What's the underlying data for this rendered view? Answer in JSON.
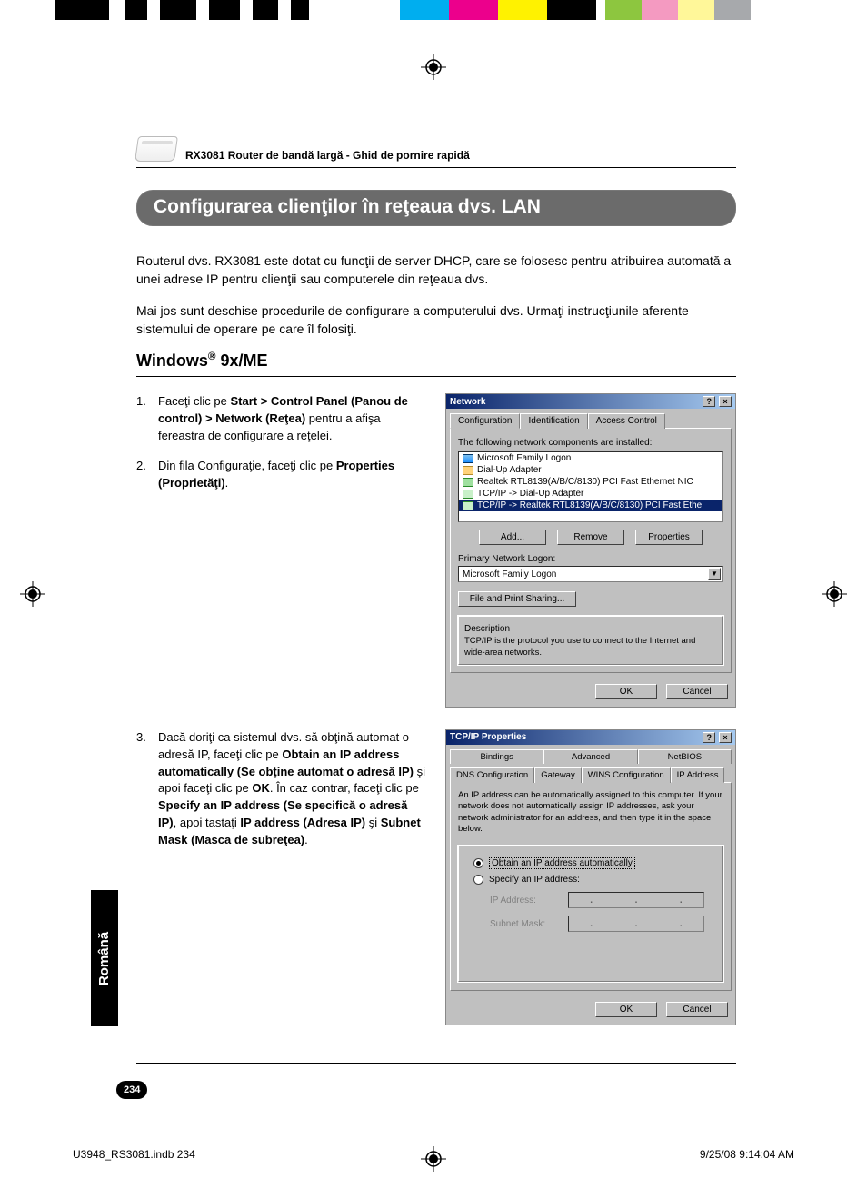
{
  "header": {
    "doc_title": "RX3081 Router de bandă largă - Ghid de pornire rapidă"
  },
  "section": {
    "title": "Configurarea clienţilor în reţeaua dvs. LAN"
  },
  "intro": {
    "p1": "Routerul dvs. RX3081 este dotat cu funcţii de server DHCP, care se folosesc pentru atribuirea automată a unei adrese IP pentru clienţii sau computerele din reţeaua dvs.",
    "p2": "Mai jos sunt deschise procedurile de configurare a computerului dvs. Urmaţi instrucţiunile aferente sistemului de operare pe care îl folosiţi."
  },
  "subheading_prefix": "Windows",
  "subheading_suffix": " 9x/ME",
  "steps": {
    "s1_num": "1.",
    "s1_a": "Faceţi clic pe ",
    "s1_b": "Start > Control Panel (Panou de control) > Network (Reţea)",
    "s1_c": " pentru a afişa fereastra de configurare a reţelei.",
    "s2_num": "2.",
    "s2_a": "Din fila Configuraţie, faceţi clic pe ",
    "s2_b": "Properties (Proprietăţi)",
    "s2_c": ".",
    "s3_num": "3.",
    "s3_a": "Dacă doriţi ca sistemul dvs. să obţină automat o adresă IP, faceţi clic pe ",
    "s3_b": "Obtain an IP address automatically (Se obţine automat o adresă IP)",
    "s3_c": " şi apoi faceţi clic pe ",
    "s3_d": "OK",
    "s3_e": ". În caz contrar, faceţi clic pe ",
    "s3_f": "Specify an IP address (Se specifică o adresă IP)",
    "s3_g": ", apoi tastaţi ",
    "s3_h": "IP address (Adresa IP)",
    "s3_i": " şi ",
    "s3_j": "Subnet Mask (Masca de subreţea)",
    "s3_k": "."
  },
  "shot1": {
    "title": "Network",
    "help_btn": "?",
    "close_btn": "×",
    "tab_config": "Configuration",
    "tab_ident": "Identification",
    "tab_access": "Access Control",
    "list_label": "The following network components are installed:",
    "items": {
      "i0": "Microsoft Family Logon",
      "i1": "Dial-Up Adapter",
      "i2": "Realtek RTL8139(A/B/C/8130) PCI Fast Ethernet NIC",
      "i3": "TCP/IP -> Dial-Up Adapter",
      "i4": "TCP/IP -> Realtek RTL8139(A/B/C/8130) PCI Fast Ethe"
    },
    "btn_add": "Add...",
    "btn_remove": "Remove",
    "btn_props": "Properties",
    "primary_label": "Primary Network Logon:",
    "primary_value": "Microsoft Family Logon",
    "btn_fps": "File and Print Sharing...",
    "desc_label": "Description",
    "desc_text": "TCP/IP is the protocol you use to connect to the Internet and wide-area networks.",
    "btn_ok": "OK",
    "btn_cancel": "Cancel"
  },
  "shot2": {
    "title": "TCP/IP Properties",
    "help_btn": "?",
    "close_btn": "×",
    "tabs_r1": {
      "t1": "Bindings",
      "t2": "Advanced",
      "t3": "NetBIOS"
    },
    "tabs_r2": {
      "t1": "DNS Configuration",
      "t2": "Gateway",
      "t3": "WINS Configuration",
      "t4": "IP Address"
    },
    "desc": "An IP address can be automatically assigned to this computer. If your network does not automatically assign IP addresses, ask your network administrator for an address, and then type it in the space below.",
    "radio_auto": "Obtain an IP address automatically",
    "radio_spec": "Specify an IP address:",
    "ip_label": "IP Address:",
    "mask_label": "Subnet Mask:",
    "btn_ok": "OK",
    "btn_cancel": "Cancel"
  },
  "lang_tab": "Română",
  "page_number": "234",
  "footer": {
    "left": "U3948_RS3081.indb   234",
    "right": "9/25/08   9:14:04 AM"
  }
}
